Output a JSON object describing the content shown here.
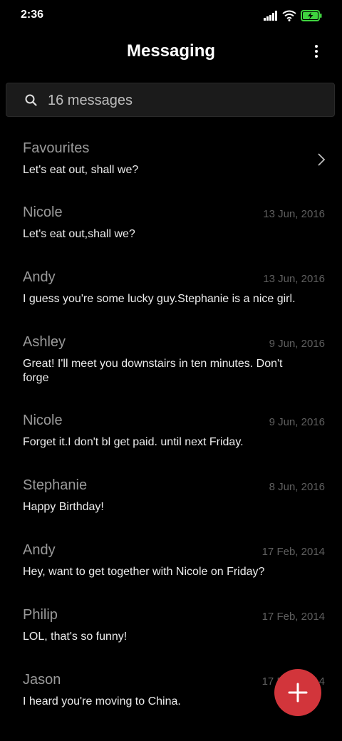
{
  "status_bar": {
    "time": "2:36",
    "icons": [
      "signal-icon",
      "wifi-icon",
      "battery-charging-icon"
    ],
    "battery_color": "#3fd23f"
  },
  "app_bar": {
    "title": "Messaging",
    "menu_icon": "more-vertical-icon"
  },
  "search": {
    "placeholder": "16 messages",
    "icon": "search-icon"
  },
  "favourites": {
    "name": "Favourites",
    "preview": "Let's eat out, shall we?",
    "icon": "chevron-right-icon"
  },
  "conversations": [
    {
      "name": "Nicole",
      "date": "13 Jun, 2016",
      "preview": "Let's eat out,shall we?"
    },
    {
      "name": "Andy",
      "date": "13 Jun, 2016",
      "preview": "I guess you're some lucky guy.Stephanie is a nice girl."
    },
    {
      "name": "Ashley",
      "date": "9 Jun, 2016",
      "preview": "Great! I'll meet you downstairs in ten minutes. Don't forge"
    },
    {
      "name": "Nicole",
      "date": "9 Jun, 2016",
      "preview": "Forget it.I don't bl get paid. until next Friday."
    },
    {
      "name": "Stephanie",
      "date": "8 Jun, 2016",
      "preview": "Happy Birthday!"
    },
    {
      "name": "Andy",
      "date": "17 Feb, 2014",
      "preview": "Hey, want to get together with Nicole on Friday?"
    },
    {
      "name": "Philip",
      "date": "17 Feb, 2014",
      "preview": "LOL, that's so funny!"
    },
    {
      "name": "Jason",
      "date": "17 Feb, 2014",
      "preview": "I heard you're moving to China."
    }
  ],
  "fab": {
    "icon": "plus-icon",
    "color": "#d2353b"
  },
  "colors": {
    "background": "#000000",
    "name_text": "#9a9a9a",
    "date_text": "#5f5f5f",
    "preview_text": "#ececec"
  }
}
